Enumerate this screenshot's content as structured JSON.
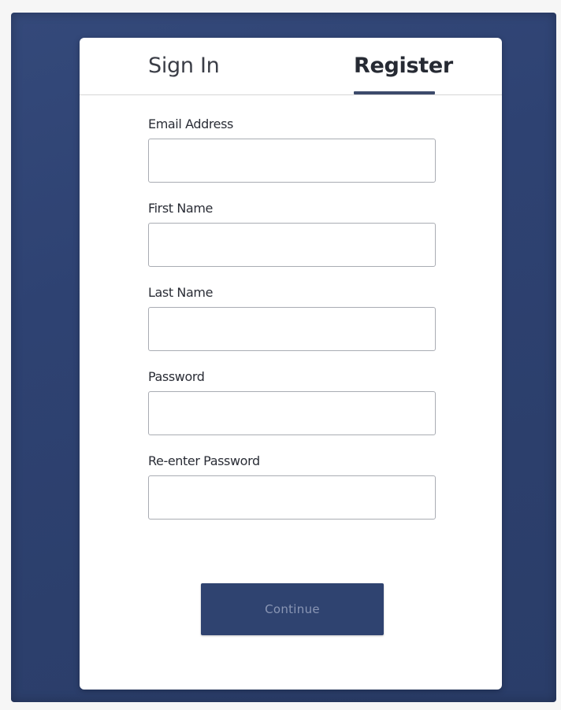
{
  "tabs": {
    "sign_in": "Sign In",
    "register": "Register",
    "active": "register"
  },
  "form": {
    "fields": [
      {
        "label": "Email Address",
        "value": ""
      },
      {
        "label": "First Name",
        "value": ""
      },
      {
        "label": "Last Name",
        "value": ""
      },
      {
        "label": "Password",
        "value": ""
      },
      {
        "label": "Re-enter Password",
        "value": ""
      }
    ],
    "submit_label": "Continue"
  },
  "colors": {
    "backdrop": "#2e4272",
    "button": "#2f4370",
    "button_text": "#8a96b4",
    "tab_underline": "#3c4a6b"
  }
}
